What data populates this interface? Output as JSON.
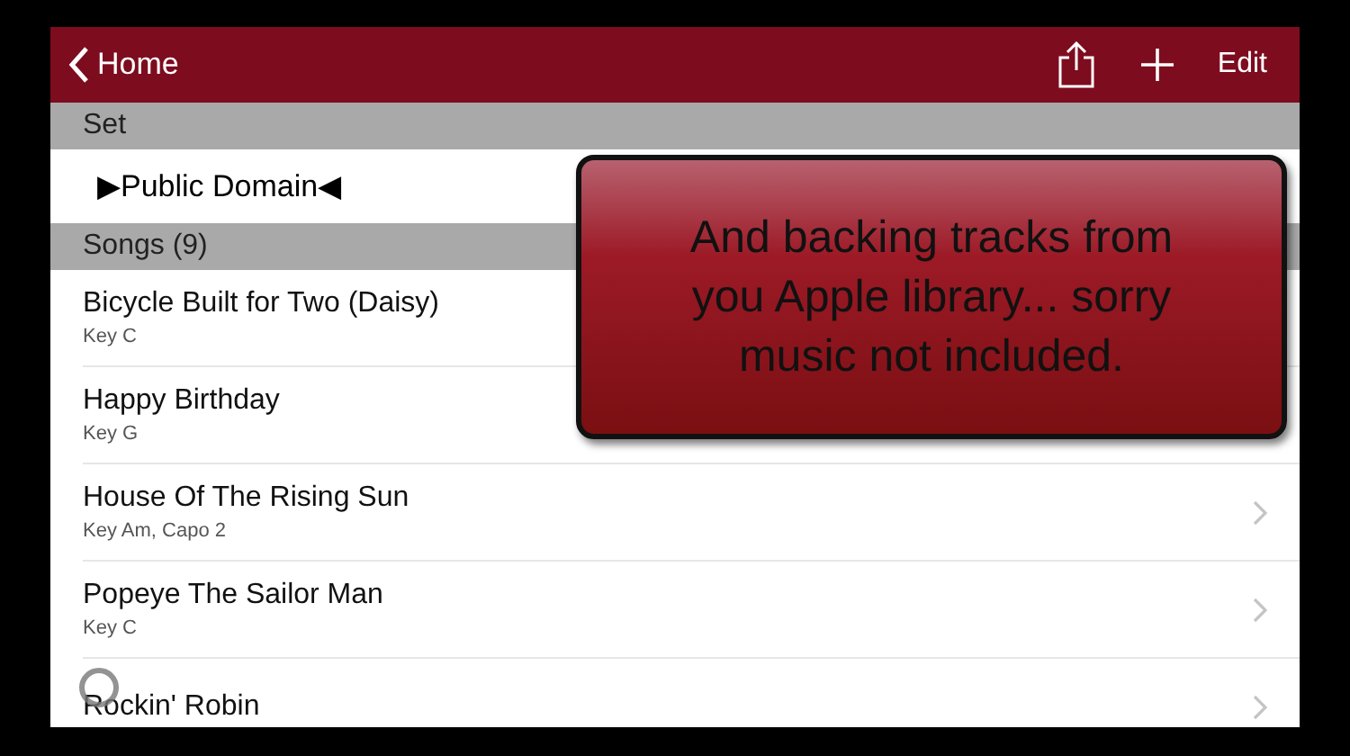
{
  "nav": {
    "back_label": "Home",
    "action": "Edit"
  },
  "sections": [
    {
      "title": "Set"
    },
    {
      "title": "Songs (9)"
    }
  ],
  "set_name": "▶Public Domain◀",
  "songs": [
    {
      "title": "Bicycle Built for Two (Daisy)",
      "subtitle": "Key C",
      "chevron": false
    },
    {
      "title": "Happy Birthday",
      "subtitle": "Key G",
      "chevron": false
    },
    {
      "title": "House Of The Rising Sun",
      "subtitle": "Key Am, Capo 2",
      "chevron": true
    },
    {
      "title": "Popeye The Sailor Man",
      "subtitle": "Key C",
      "chevron": true
    },
    {
      "title": "Rockin' Robin",
      "chevron": true
    }
  ],
  "callout": "And backing tracks from you Apple library... sorry music not included."
}
